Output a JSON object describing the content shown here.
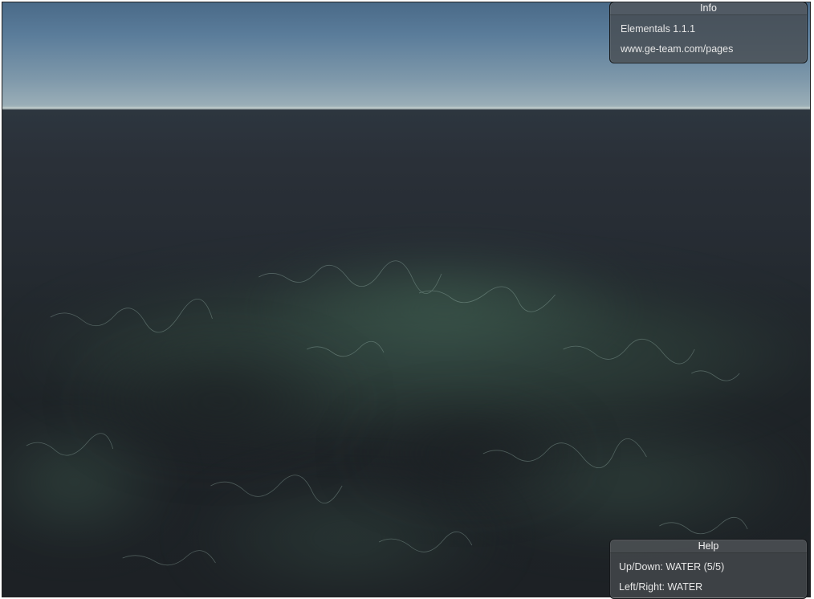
{
  "info_panel": {
    "title": "Info",
    "version": "Elementals 1.1.1",
    "url": "www.ge-team.com/pages"
  },
  "help_panel": {
    "title": "Help",
    "up_down": "Up/Down: WATER (5/5)",
    "left_right": "Left/Right: WATER"
  },
  "scene": {
    "sky_color": "#5a7c9a",
    "horizon_color": "#b3c1c2",
    "water_color": "#22282d",
    "shallow_glow_color": "#3d5a4f"
  }
}
